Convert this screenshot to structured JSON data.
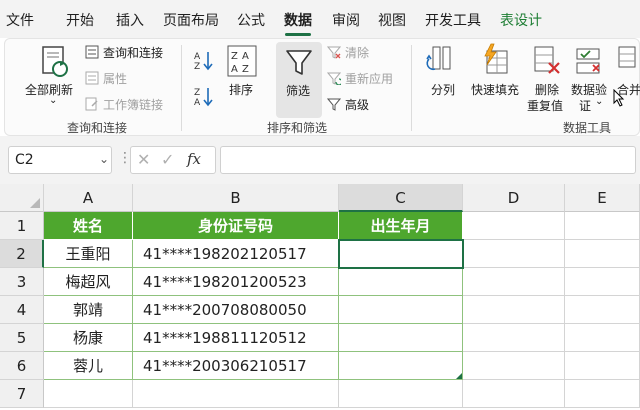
{
  "tabs": [
    "文件",
    "开始",
    "插入",
    "页面布局",
    "公式",
    "数据",
    "审阅",
    "视图",
    "开发工具",
    "表设计"
  ],
  "ribbon": {
    "query_group": {
      "refresh_all": "全部刷新",
      "query_connect": "查询和连接",
      "properties": "属性",
      "workbook_links": "工作簿链接",
      "label": "查询和连接"
    },
    "sort_group": {
      "sort": "排序",
      "filter": "筛选",
      "clear": "清除",
      "reapply": "重新应用",
      "advanced": "高级",
      "label": "排序和筛选"
    },
    "tools_group": {
      "split": "分列",
      "flash_fill": "快速填充",
      "remove_dup_1": "删除",
      "remove_dup_2": "重复值",
      "validation_1": "数据验",
      "validation_2": "证",
      "consolidate": "合并计",
      "label": "数据工具"
    }
  },
  "formula_bar": {
    "name_box": "C2",
    "fx": "fx",
    "formula": ""
  },
  "columns": [
    "A",
    "B",
    "C",
    "D",
    "E"
  ],
  "rows": [
    "1",
    "2",
    "3",
    "4",
    "5",
    "6",
    "7"
  ],
  "table": {
    "headers": [
      "姓名",
      "身份证号码",
      "出生年月"
    ],
    "rows": [
      [
        "王重阳",
        "41****198202120517",
        ""
      ],
      [
        "梅超风",
        "41****198201200523",
        ""
      ],
      [
        "郭靖",
        "41****200708080050",
        ""
      ],
      [
        "杨康",
        "41****198811120512",
        ""
      ],
      [
        "蓉儿",
        "41****200306210517",
        ""
      ]
    ]
  },
  "colors": {
    "accent": "#1e7145",
    "table_header": "#4ea72e",
    "table_border": "#8fc27d",
    "design_tab": "#1e7e34"
  }
}
